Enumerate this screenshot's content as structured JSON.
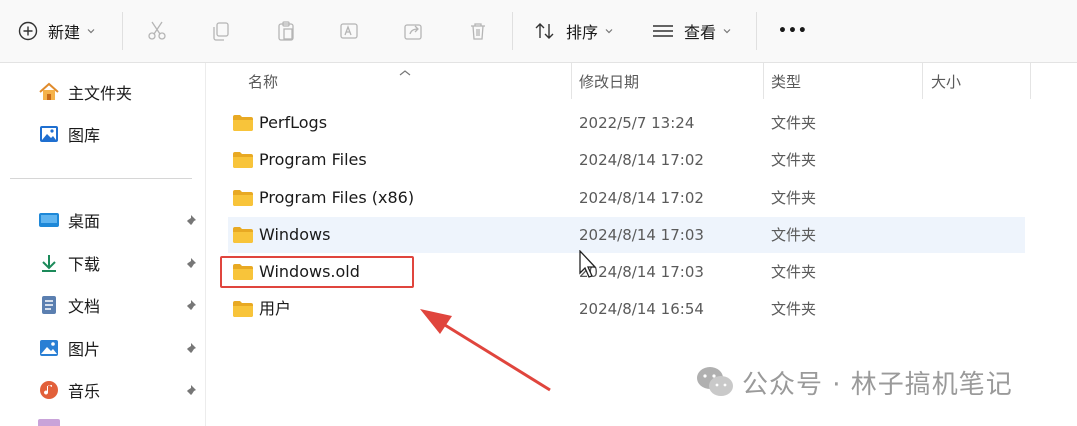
{
  "toolbar": {
    "new_label": "新建",
    "sort_label": "排序",
    "view_label": "查看",
    "more_label": "•••"
  },
  "sidebar": {
    "items": [
      {
        "label": "主文件夹",
        "icon": "home-icon"
      },
      {
        "label": "图库",
        "icon": "gallery-icon"
      },
      {
        "label": "桌面",
        "icon": "desktop-icon",
        "pinned": true
      },
      {
        "label": "下载",
        "icon": "download-icon",
        "pinned": true
      },
      {
        "label": "文档",
        "icon": "document-icon",
        "pinned": true
      },
      {
        "label": "图片",
        "icon": "pictures-icon",
        "pinned": true
      },
      {
        "label": "音乐",
        "icon": "music-icon",
        "pinned": true
      }
    ]
  },
  "columns": {
    "name": "名称",
    "modified": "修改日期",
    "type": "类型",
    "size": "大小"
  },
  "files": [
    {
      "name": "PerfLogs",
      "modified": "2022/5/7 13:24",
      "type": "文件夹"
    },
    {
      "name": "Program Files",
      "modified": "2024/8/14 17:02",
      "type": "文件夹"
    },
    {
      "name": "Program Files (x86)",
      "modified": "2024/8/14 17:02",
      "type": "文件夹"
    },
    {
      "name": "Windows",
      "modified": "2024/8/14 17:03",
      "type": "文件夹"
    },
    {
      "name": "Windows.old",
      "modified": "2024/8/14 17:03",
      "type": "文件夹"
    },
    {
      "name": "用户",
      "modified": "2024/8/14 16:54",
      "type": "文件夹"
    }
  ],
  "watermark": {
    "text": "公众号 · 林子搞机笔记"
  },
  "colors": {
    "accent": "#0067c0",
    "folder": "#f8c43a",
    "highlight": "#e0453d",
    "selected_row": "#eef4fc"
  }
}
